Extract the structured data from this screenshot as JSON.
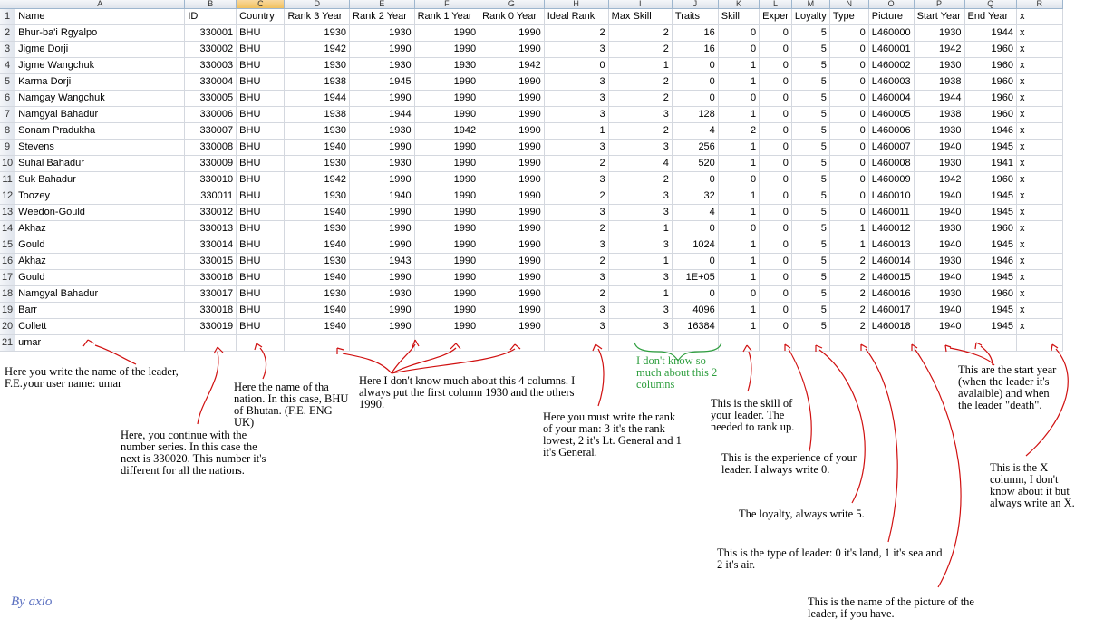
{
  "sheet": {
    "column_letters": [
      "A",
      "B",
      "C",
      "D",
      "E",
      "F",
      "G",
      "H",
      "I",
      "J",
      "K",
      "L",
      "M",
      "N",
      "O",
      "P",
      "Q",
      "R"
    ],
    "selected_column": "C",
    "headers": [
      "Name",
      "ID",
      "Country",
      "Rank 3 Year",
      "Rank 2 Year",
      "Rank 1 Year",
      "Rank 0 Year",
      "Ideal Rank",
      "Max Skill",
      "Traits",
      "Skill",
      "Exper",
      "Loyalty",
      "Type",
      "Picture",
      "Start Year",
      "End Year",
      "x"
    ],
    "rows": [
      [
        "Bhur-ba'i Rgyalpo",
        "330001",
        "BHU",
        "1930",
        "1930",
        "1990",
        "1990",
        "2",
        "2",
        "16",
        "0",
        "0",
        "5",
        "0",
        "L460000",
        "1930",
        "1944",
        "x"
      ],
      [
        "Jigme Dorji",
        "330002",
        "BHU",
        "1942",
        "1990",
        "1990",
        "1990",
        "3",
        "2",
        "16",
        "0",
        "0",
        "5",
        "0",
        "L460001",
        "1942",
        "1960",
        "x"
      ],
      [
        "Jigme Wangchuk",
        "330003",
        "BHU",
        "1930",
        "1930",
        "1930",
        "1942",
        "0",
        "1",
        "0",
        "1",
        "0",
        "5",
        "0",
        "L460002",
        "1930",
        "1960",
        "x"
      ],
      [
        "Karma Dorji",
        "330004",
        "BHU",
        "1938",
        "1945",
        "1990",
        "1990",
        "3",
        "2",
        "0",
        "1",
        "0",
        "5",
        "0",
        "L460003",
        "1938",
        "1960",
        "x"
      ],
      [
        "Namgay Wangchuk",
        "330005",
        "BHU",
        "1944",
        "1990",
        "1990",
        "1990",
        "3",
        "2",
        "0",
        "0",
        "0",
        "5",
        "0",
        "L460004",
        "1944",
        "1960",
        "x"
      ],
      [
        "Namgyal Bahadur",
        "330006",
        "BHU",
        "1938",
        "1944",
        "1990",
        "1990",
        "3",
        "3",
        "128",
        "1",
        "0",
        "5",
        "0",
        "L460005",
        "1938",
        "1960",
        "x"
      ],
      [
        "Sonam Pradukha",
        "330007",
        "BHU",
        "1930",
        "1930",
        "1942",
        "1990",
        "1",
        "2",
        "4",
        "2",
        "0",
        "5",
        "0",
        "L460006",
        "1930",
        "1946",
        "x"
      ],
      [
        "Stevens",
        "330008",
        "BHU",
        "1940",
        "1990",
        "1990",
        "1990",
        "3",
        "3",
        "256",
        "1",
        "0",
        "5",
        "0",
        "L460007",
        "1940",
        "1945",
        "x"
      ],
      [
        "Suhal Bahadur",
        "330009",
        "BHU",
        "1930",
        "1930",
        "1990",
        "1990",
        "2",
        "4",
        "520",
        "1",
        "0",
        "5",
        "0",
        "L460008",
        "1930",
        "1941",
        "x"
      ],
      [
        "Suk Bahadur",
        "330010",
        "BHU",
        "1942",
        "1990",
        "1990",
        "1990",
        "3",
        "2",
        "0",
        "0",
        "0",
        "5",
        "0",
        "L460009",
        "1942",
        "1960",
        "x"
      ],
      [
        "Toozey",
        "330011",
        "BHU",
        "1930",
        "1940",
        "1990",
        "1990",
        "2",
        "3",
        "32",
        "1",
        "0",
        "5",
        "0",
        "L460010",
        "1940",
        "1945",
        "x"
      ],
      [
        "Weedon-Gould",
        "330012",
        "BHU",
        "1940",
        "1990",
        "1990",
        "1990",
        "3",
        "3",
        "4",
        "1",
        "0",
        "5",
        "0",
        "L460011",
        "1940",
        "1945",
        "x"
      ],
      [
        "Akhaz",
        "330013",
        "BHU",
        "1930",
        "1990",
        "1990",
        "1990",
        "2",
        "1",
        "0",
        "0",
        "0",
        "5",
        "1",
        "L460012",
        "1930",
        "1960",
        "x"
      ],
      [
        "Gould",
        "330014",
        "BHU",
        "1940",
        "1990",
        "1990",
        "1990",
        "3",
        "3",
        "1024",
        "1",
        "0",
        "5",
        "1",
        "L460013",
        "1940",
        "1945",
        "x"
      ],
      [
        "Akhaz",
        "330015",
        "BHU",
        "1930",
        "1943",
        "1990",
        "1990",
        "2",
        "1",
        "0",
        "1",
        "0",
        "5",
        "2",
        "L460014",
        "1930",
        "1946",
        "x"
      ],
      [
        "Gould",
        "330016",
        "BHU",
        "1940",
        "1990",
        "1990",
        "1990",
        "3",
        "3",
        "1E+05",
        "1",
        "0",
        "5",
        "2",
        "L460015",
        "1940",
        "1945",
        "x"
      ],
      [
        "Namgyal Bahadur",
        "330017",
        "BHU",
        "1930",
        "1930",
        "1990",
        "1990",
        "2",
        "1",
        "0",
        "0",
        "0",
        "5",
        "2",
        "L460016",
        "1930",
        "1960",
        "x"
      ],
      [
        "Barr",
        "330018",
        "BHU",
        "1940",
        "1990",
        "1990",
        "1990",
        "3",
        "3",
        "4096",
        "1",
        "0",
        "5",
        "2",
        "L460017",
        "1940",
        "1945",
        "x"
      ],
      [
        "Collett",
        "330019",
        "BHU",
        "1940",
        "1990",
        "1990",
        "1990",
        "3",
        "3",
        "16384",
        "1",
        "0",
        "5",
        "2",
        "L460018",
        "1940",
        "1945",
        "x"
      ],
      [
        "umar",
        "",
        "",
        "",
        "",
        "",
        "",
        "",
        "",
        "",
        "",
        "",
        "",
        "",
        "",
        "",
        "",
        ""
      ]
    ]
  },
  "annotations": {
    "name": "Here you write the name of the leader, F.E.your user name: umar",
    "id": "Here, you continue with the number series. In this case the next is 330020. This number it's different for all the nations.",
    "nation": "Here the name of tha nation. In this case, BHU of Bhutan. (F.E. ENG UK)",
    "rank_years": "Here I don't know much about this 4 columns. I always put the first column 1930 and the others 1990.",
    "ideal_rank": "Here you must write the rank of your man: 3 it's the rank lowest, 2 it's Lt. General and 1 it's General.",
    "unknown_two": "I don't know so much about this 2 columns",
    "skill": "This is the skill of your leader. The needed to rank up.",
    "experience": "This is the experience of your leader. I always write 0.",
    "loyalty": "The loyalty, always write 5.",
    "type": "This is the type of leader: 0 it's land, 1 it's sea and 2 it's air.",
    "picture": "This is the name of the picture of the leader, if you have.",
    "years": "This are the start year (when the leader it's avalaible) and when the leader \"death\".",
    "x_col": "This is the X column, I don't know about it but always write an X.",
    "signature": "By axio"
  },
  "colors": {
    "annotation_arrow": "#d01010",
    "green_note": "#2e9e3e",
    "selected_header": "#f1c15f"
  }
}
